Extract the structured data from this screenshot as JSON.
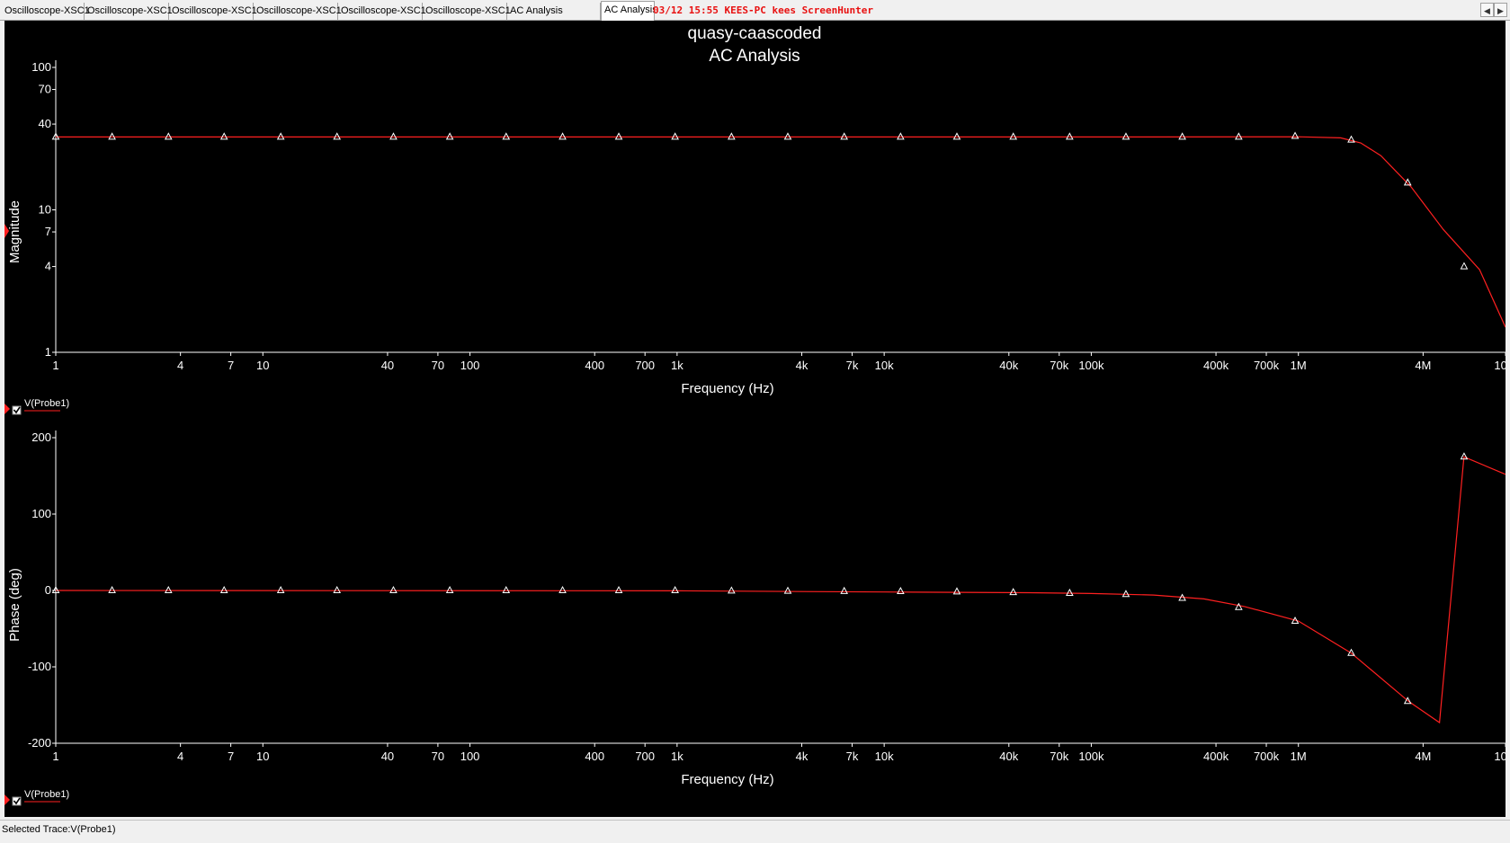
{
  "tabs": [
    {
      "label": "Oscilloscope-XSC1"
    },
    {
      "label": "Oscilloscope-XSC1"
    },
    {
      "label": "Oscilloscope-XSC1"
    },
    {
      "label": "Oscilloscope-XSC1"
    },
    {
      "label": "Oscilloscope-XSC1"
    },
    {
      "label": "Oscilloscope-XSC1"
    },
    {
      "label": "AC Analysis"
    },
    {
      "label": "AC Analysis"
    }
  ],
  "overlay_stamp": "03/12  15:55  KEES-PC  kees  ScreenHunter",
  "nav": {
    "left_icon": "arrow-left-icon",
    "right_icon": "arrow-right-icon"
  },
  "status_bar": {
    "text": "Selected Trace:V(Probe1)"
  },
  "colors": {
    "background": "#000000",
    "trace": "#ff2020",
    "axis": "#ffffff",
    "text": "#ffffff"
  },
  "chart_data": [
    {
      "type": "line",
      "title": "quasy-caascoded",
      "subtitle": "AC Analysis",
      "xlabel": "Frequency (Hz)",
      "ylabel": "Magnitude",
      "x_scale": "log",
      "y_scale": "log",
      "xlim": [
        1,
        10000000
      ],
      "ylim": [
        1,
        100
      ],
      "x_ticks": [
        {
          "value": 1,
          "label": "1"
        },
        {
          "value": 4,
          "label": "4"
        },
        {
          "value": 7,
          "label": "7"
        },
        {
          "value": 10,
          "label": "10"
        },
        {
          "value": 40,
          "label": "40"
        },
        {
          "value": 70,
          "label": "70"
        },
        {
          "value": 100,
          "label": "100"
        },
        {
          "value": 400,
          "label": "400"
        },
        {
          "value": 700,
          "label": "700"
        },
        {
          "value": 1000,
          "label": "1k"
        },
        {
          "value": 4000,
          "label": "4k"
        },
        {
          "value": 7000,
          "label": "7k"
        },
        {
          "value": 10000,
          "label": "10k"
        },
        {
          "value": 40000,
          "label": "40k"
        },
        {
          "value": 70000,
          "label": "70k"
        },
        {
          "value": 100000,
          "label": "100k"
        },
        {
          "value": 400000,
          "label": "400k"
        },
        {
          "value": 700000,
          "label": "700k"
        },
        {
          "value": 1000000,
          "label": "1M"
        },
        {
          "value": 4000000,
          "label": "4M"
        },
        {
          "value": 10000000,
          "label": "10M"
        }
      ],
      "y_ticks": [
        {
          "value": 100,
          "label": "100"
        },
        {
          "value": 70,
          "label": "70"
        },
        {
          "value": 40,
          "label": "40"
        },
        {
          "value": 10,
          "label": "10"
        },
        {
          "value": 7,
          "label": "7"
        },
        {
          "value": 4,
          "label": "4"
        },
        {
          "value": 1,
          "label": "1"
        }
      ],
      "legend": "V(Probe1)",
      "series": [
        {
          "name": "V(Probe1)",
          "x": [
            1,
            10000,
            100000,
            1000000,
            1600000,
            2000000,
            2500000,
            3500000,
            5000000,
            7500000,
            10000000
          ],
          "y": [
            32.5,
            32.5,
            32.5,
            32.6,
            32.0,
            29.5,
            24.0,
            14.5,
            7.3,
            3.8,
            1.5
          ]
        }
      ],
      "marker_x": [
        1,
        1.87,
        3.5,
        6.5,
        12.2,
        22.8,
        42.7,
        79.9,
        149.5,
        280,
        523,
        978,
        1831,
        3425,
        6410,
        12000,
        22440,
        42000,
        78600,
        147000,
        275000,
        515000,
        964000,
        1800000,
        3370000,
        6310000
      ],
      "marker_y": [
        32.5,
        32.5,
        32.5,
        32.5,
        32.5,
        32.5,
        32.5,
        32.5,
        32.5,
        32.5,
        32.5,
        32.5,
        32.5,
        32.5,
        32.5,
        32.5,
        32.5,
        32.5,
        32.5,
        32.5,
        32.5,
        32.5,
        32.9,
        31.0,
        15.5,
        4.0
      ]
    },
    {
      "type": "line",
      "xlabel": "Frequency (Hz)",
      "ylabel": "Phase (deg)",
      "x_scale": "log",
      "xlim": [
        1,
        10000000
      ],
      "ylim": [
        -200,
        200
      ],
      "x_ticks": [
        {
          "value": 1,
          "label": "1"
        },
        {
          "value": 4,
          "label": "4"
        },
        {
          "value": 7,
          "label": "7"
        },
        {
          "value": 10,
          "label": "10"
        },
        {
          "value": 40,
          "label": "40"
        },
        {
          "value": 70,
          "label": "70"
        },
        {
          "value": 100,
          "label": "100"
        },
        {
          "value": 400,
          "label": "400"
        },
        {
          "value": 700,
          "label": "700"
        },
        {
          "value": 1000,
          "label": "1k"
        },
        {
          "value": 4000,
          "label": "4k"
        },
        {
          "value": 7000,
          "label": "7k"
        },
        {
          "value": 10000,
          "label": "10k"
        },
        {
          "value": 40000,
          "label": "40k"
        },
        {
          "value": 70000,
          "label": "70k"
        },
        {
          "value": 100000,
          "label": "100k"
        },
        {
          "value": 400000,
          "label": "400k"
        },
        {
          "value": 700000,
          "label": "700k"
        },
        {
          "value": 1000000,
          "label": "1M"
        },
        {
          "value": 4000000,
          "label": "4M"
        },
        {
          "value": 10000000,
          "label": "10M"
        }
      ],
      "y_ticks": [
        {
          "value": 200,
          "label": "200"
        },
        {
          "value": 100,
          "label": "100"
        },
        {
          "value": 0,
          "label": "0"
        },
        {
          "value": -100,
          "label": "-100"
        },
        {
          "value": -200,
          "label": "-200"
        }
      ],
      "legend": "V(Probe1)",
      "series": [
        {
          "name": "V(Probe1)",
          "x": [
            1,
            1000,
            10000,
            50000,
            100000,
            200000,
            350000,
            550000,
            1000000,
            1800000,
            3400000,
            4800000,
            6300000,
            10000000
          ],
          "y": [
            0,
            -0.5,
            -2,
            -3,
            -4,
            -6,
            -11,
            -21,
            -40,
            -82,
            -145,
            -173,
            175,
            152
          ]
        }
      ],
      "marker_x": [
        1,
        1.87,
        3.5,
        6.5,
        12.2,
        22.8,
        42.7,
        79.9,
        149.5,
        280,
        523,
        978,
        1831,
        3425,
        6410,
        12000,
        22440,
        42000,
        78600,
        147000,
        275000,
        515000,
        964000,
        1800000,
        3370000,
        6310000
      ],
      "marker_y": [
        0,
        0,
        0,
        0,
        0,
        0,
        0,
        0,
        0,
        0,
        0,
        0,
        -0.5,
        -0.8,
        -1,
        -1.2,
        -1.6,
        -2.5,
        -3.5,
        -5,
        -10,
        -22,
        -40,
        -82,
        -145,
        175
      ]
    }
  ]
}
